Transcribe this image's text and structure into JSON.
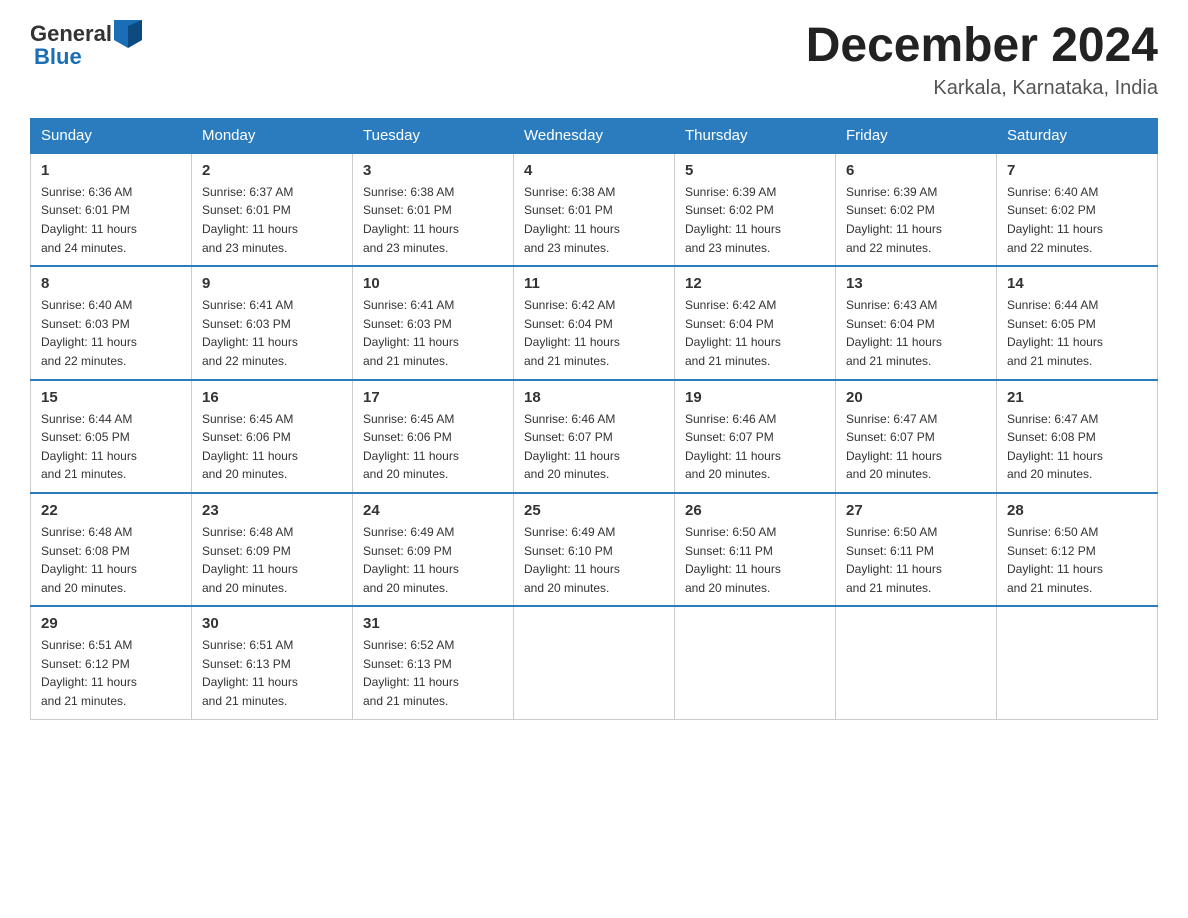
{
  "header": {
    "logo_general": "General",
    "logo_blue": "Blue",
    "month_title": "December 2024",
    "location": "Karkala, Karnataka, India"
  },
  "weekdays": [
    "Sunday",
    "Monday",
    "Tuesday",
    "Wednesday",
    "Thursday",
    "Friday",
    "Saturday"
  ],
  "weeks": [
    [
      {
        "num": "1",
        "sunrise": "6:36 AM",
        "sunset": "6:01 PM",
        "daylight": "11 hours and 24 minutes."
      },
      {
        "num": "2",
        "sunrise": "6:37 AM",
        "sunset": "6:01 PM",
        "daylight": "11 hours and 23 minutes."
      },
      {
        "num": "3",
        "sunrise": "6:38 AM",
        "sunset": "6:01 PM",
        "daylight": "11 hours and 23 minutes."
      },
      {
        "num": "4",
        "sunrise": "6:38 AM",
        "sunset": "6:01 PM",
        "daylight": "11 hours and 23 minutes."
      },
      {
        "num": "5",
        "sunrise": "6:39 AM",
        "sunset": "6:02 PM",
        "daylight": "11 hours and 23 minutes."
      },
      {
        "num": "6",
        "sunrise": "6:39 AM",
        "sunset": "6:02 PM",
        "daylight": "11 hours and 22 minutes."
      },
      {
        "num": "7",
        "sunrise": "6:40 AM",
        "sunset": "6:02 PM",
        "daylight": "11 hours and 22 minutes."
      }
    ],
    [
      {
        "num": "8",
        "sunrise": "6:40 AM",
        "sunset": "6:03 PM",
        "daylight": "11 hours and 22 minutes."
      },
      {
        "num": "9",
        "sunrise": "6:41 AM",
        "sunset": "6:03 PM",
        "daylight": "11 hours and 22 minutes."
      },
      {
        "num": "10",
        "sunrise": "6:41 AM",
        "sunset": "6:03 PM",
        "daylight": "11 hours and 21 minutes."
      },
      {
        "num": "11",
        "sunrise": "6:42 AM",
        "sunset": "6:04 PM",
        "daylight": "11 hours and 21 minutes."
      },
      {
        "num": "12",
        "sunrise": "6:42 AM",
        "sunset": "6:04 PM",
        "daylight": "11 hours and 21 minutes."
      },
      {
        "num": "13",
        "sunrise": "6:43 AM",
        "sunset": "6:04 PM",
        "daylight": "11 hours and 21 minutes."
      },
      {
        "num": "14",
        "sunrise": "6:44 AM",
        "sunset": "6:05 PM",
        "daylight": "11 hours and 21 minutes."
      }
    ],
    [
      {
        "num": "15",
        "sunrise": "6:44 AM",
        "sunset": "6:05 PM",
        "daylight": "11 hours and 21 minutes."
      },
      {
        "num": "16",
        "sunrise": "6:45 AM",
        "sunset": "6:06 PM",
        "daylight": "11 hours and 20 minutes."
      },
      {
        "num": "17",
        "sunrise": "6:45 AM",
        "sunset": "6:06 PM",
        "daylight": "11 hours and 20 minutes."
      },
      {
        "num": "18",
        "sunrise": "6:46 AM",
        "sunset": "6:07 PM",
        "daylight": "11 hours and 20 minutes."
      },
      {
        "num": "19",
        "sunrise": "6:46 AM",
        "sunset": "6:07 PM",
        "daylight": "11 hours and 20 minutes."
      },
      {
        "num": "20",
        "sunrise": "6:47 AM",
        "sunset": "6:07 PM",
        "daylight": "11 hours and 20 minutes."
      },
      {
        "num": "21",
        "sunrise": "6:47 AM",
        "sunset": "6:08 PM",
        "daylight": "11 hours and 20 minutes."
      }
    ],
    [
      {
        "num": "22",
        "sunrise": "6:48 AM",
        "sunset": "6:08 PM",
        "daylight": "11 hours and 20 minutes."
      },
      {
        "num": "23",
        "sunrise": "6:48 AM",
        "sunset": "6:09 PM",
        "daylight": "11 hours and 20 minutes."
      },
      {
        "num": "24",
        "sunrise": "6:49 AM",
        "sunset": "6:09 PM",
        "daylight": "11 hours and 20 minutes."
      },
      {
        "num": "25",
        "sunrise": "6:49 AM",
        "sunset": "6:10 PM",
        "daylight": "11 hours and 20 minutes."
      },
      {
        "num": "26",
        "sunrise": "6:50 AM",
        "sunset": "6:11 PM",
        "daylight": "11 hours and 20 minutes."
      },
      {
        "num": "27",
        "sunrise": "6:50 AM",
        "sunset": "6:11 PM",
        "daylight": "11 hours and 21 minutes."
      },
      {
        "num": "28",
        "sunrise": "6:50 AM",
        "sunset": "6:12 PM",
        "daylight": "11 hours and 21 minutes."
      }
    ],
    [
      {
        "num": "29",
        "sunrise": "6:51 AM",
        "sunset": "6:12 PM",
        "daylight": "11 hours and 21 minutes."
      },
      {
        "num": "30",
        "sunrise": "6:51 AM",
        "sunset": "6:13 PM",
        "daylight": "11 hours and 21 minutes."
      },
      {
        "num": "31",
        "sunrise": "6:52 AM",
        "sunset": "6:13 PM",
        "daylight": "11 hours and 21 minutes."
      },
      null,
      null,
      null,
      null
    ]
  ],
  "labels": {
    "sunrise": "Sunrise:",
    "sunset": "Sunset:",
    "daylight": "Daylight:"
  }
}
